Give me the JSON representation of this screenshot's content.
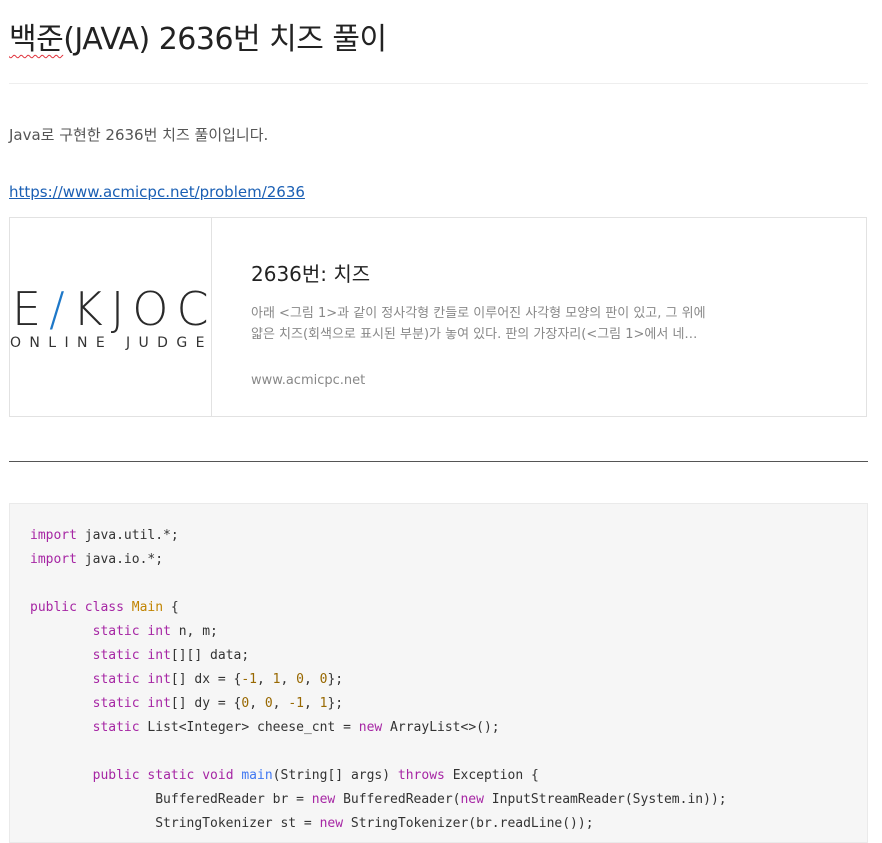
{
  "post": {
    "title_part1": "백준",
    "title_part2": "(JAVA) 2636번 치즈 풀이",
    "intro": "Java로 구현한 2636번 치즈 풀이입니다.",
    "link": "https://www.acmicpc.net/problem/2636"
  },
  "card": {
    "logo_text_before": "E",
    "logo_slash": "/",
    "logo_text_after": "KJOC",
    "logo_sub": "ONLINE JUDGE",
    "title": "2636번: 치즈",
    "description": "아래 <그림 1>과 같이 정사각형 칸들로 이루어진 사각형 모양의 판이 있고, 그 위에 얇은 치즈(회색으로 표시된 부분)가 놓여 있다. 판의 가장자리(<그림 1>에서 네…",
    "domain": "www.acmicpc.net"
  },
  "code": {
    "language": "java",
    "lines": [
      "import java.util.*;",
      "import java.io.*;",
      "",
      "public class Main {",
      "        static int n, m;",
      "        static int[][] data;",
      "        static int[] dx = {-1, 1, 0, 0};",
      "        static int[] dy = {0, 0, -1, 1};",
      "        static List<Integer> cheese_cnt = new ArrayList<>();",
      "",
      "        public static void main(String[] args) throws Exception {",
      "                BufferedReader br = new BufferedReader(new InputStreamReader(System.in));",
      "                StringTokenizer st = new StringTokenizer(br.readLine());"
    ]
  },
  "colors": {
    "keyword": "#a626a4",
    "class_name": "#c18401",
    "number": "#986801",
    "function": "#4078f2",
    "link": "#1a5fb4"
  }
}
